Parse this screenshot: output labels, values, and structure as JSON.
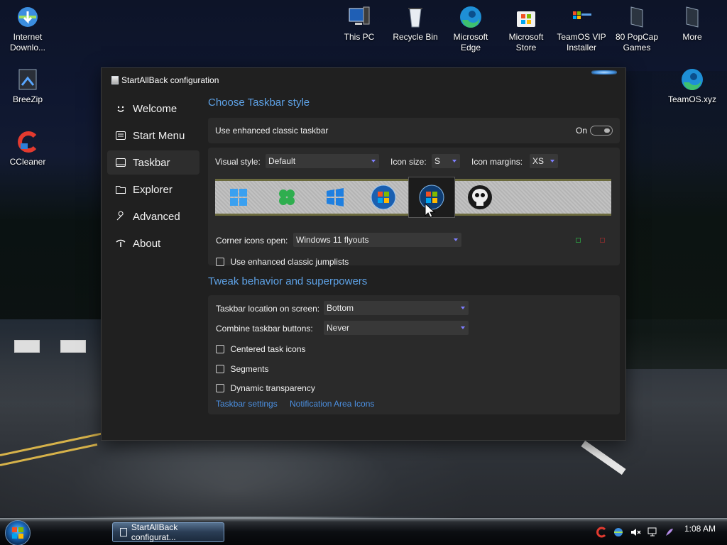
{
  "desktop": {
    "icons": [
      {
        "label": "Internet Downlo...",
        "icon": "internet-download-manager-icon"
      },
      {
        "label": "BreeZip",
        "icon": "breezip-icon"
      },
      {
        "label": "CCleaner",
        "icon": "ccleaner-icon"
      },
      {
        "label": "This PC",
        "icon": "this-pc-icon"
      },
      {
        "label": "Recycle Bin",
        "icon": "recycle-bin-icon"
      },
      {
        "label": "Microsoft Edge",
        "icon": "edge-icon"
      },
      {
        "label": "Microsoft Store",
        "icon": "store-icon"
      },
      {
        "label": "TeamOS VIP Installer",
        "icon": "teamos-installer-icon"
      },
      {
        "label": "80 PopCap Games",
        "icon": "popcap-games-icon"
      },
      {
        "label": "More",
        "icon": "more-icon"
      },
      {
        "label": "TeamOS.xyz",
        "icon": "edge-icon"
      }
    ]
  },
  "window": {
    "title": "StartAllBack configuration",
    "nav": [
      {
        "label": "Welcome",
        "icon": "smiley-icon"
      },
      {
        "label": "Start Menu",
        "icon": "start-menu-icon"
      },
      {
        "label": "Taskbar",
        "icon": "taskbar-icon",
        "active": true
      },
      {
        "label": "Explorer",
        "icon": "folder-icon"
      },
      {
        "label": "Advanced",
        "icon": "wrench-icon"
      },
      {
        "label": "About",
        "icon": "about-icon"
      }
    ],
    "section1": {
      "heading": "Choose Taskbar style",
      "enhanced_label": "Use enhanced classic taskbar",
      "enhanced_state": "On",
      "visual_style_label": "Visual style:",
      "visual_style_value": "Default",
      "icon_size_label": "Icon size:",
      "icon_size_value": "S",
      "icon_margins_label": "Icon margins:",
      "icon_margins_value": "XS",
      "style_options": [
        "windows-11-logo",
        "clover-logo",
        "windows-10-logo",
        "windows-7-orb",
        "windows-vista-orb",
        "skull-logo"
      ],
      "selected_style": "windows-vista-orb",
      "corner_icons_label": "Corner icons open:",
      "corner_icons_value": "Windows 11 flyouts",
      "jumplists_label": "Use enhanced classic jumplists"
    },
    "section2": {
      "heading": "Tweak behavior and superpowers",
      "location_label": "Taskbar location on screen:",
      "location_value": "Bottom",
      "combine_label": "Combine taskbar buttons:",
      "combine_value": "Never",
      "centered_label": "Centered task icons",
      "segments_label": "Segments",
      "dynamic_label": "Dynamic transparency",
      "link1": "Taskbar settings",
      "link2": "Notification Area Icons"
    }
  },
  "taskbar": {
    "button_label": "StartAllBack configurat...",
    "clock": "1:08 AM"
  },
  "colors": {
    "accent": "#5ea2e6",
    "window_bg": "#202020",
    "card_bg": "#2a2a2a"
  }
}
